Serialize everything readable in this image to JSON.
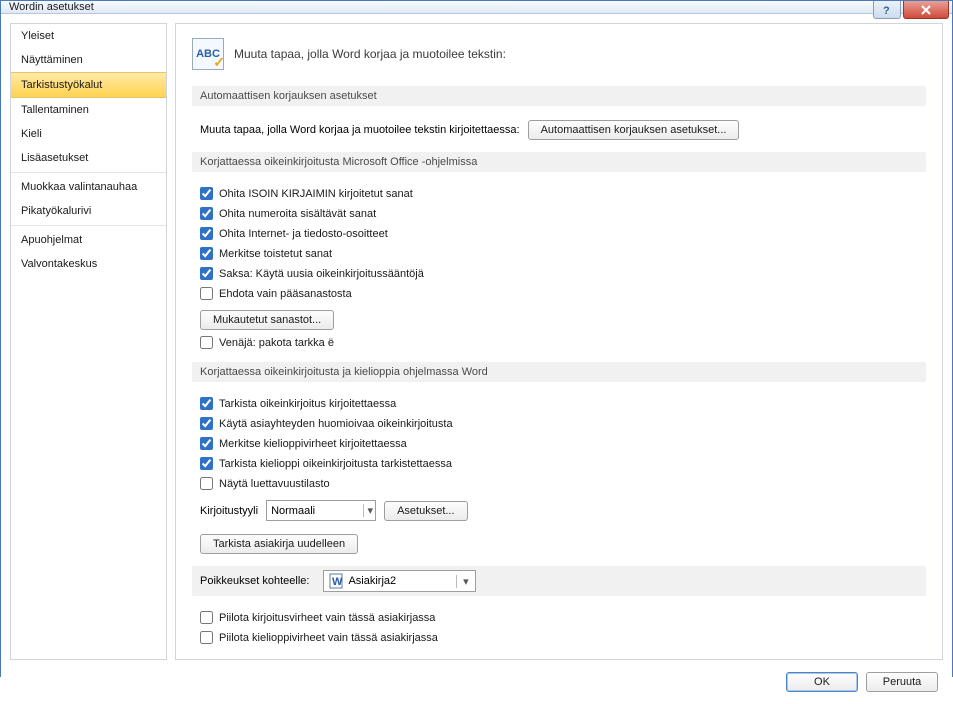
{
  "title": "Wordin asetukset",
  "sidebar": {
    "groups": [
      [
        "Yleiset",
        "Näyttäminen",
        "Tarkistustyökalut",
        "Tallentaminen",
        "Kieli",
        "Lisäasetukset"
      ],
      [
        "Muokkaa valintanauhaa",
        "Pikatyökalurivi"
      ],
      [
        "Apuohjelmat",
        "Valvontakeskus"
      ]
    ],
    "selected": "Tarkistustyökalut"
  },
  "page": {
    "icon_text": "ABC",
    "heading": "Muuta tapaa, jolla Word korjaa ja muotoilee tekstin:"
  },
  "sections": {
    "autocorrect": {
      "title": "Automaattisen korjauksen asetukset",
      "desc": "Muuta tapaa, jolla Word korjaa ja muotoilee tekstin kirjoitettaessa:",
      "button": "Automaattisen korjauksen asetukset..."
    },
    "office_spell": {
      "title": "Korjattaessa oikeinkirjoitusta Microsoft Office -ohjelmissa",
      "checks": [
        {
          "label": "Ohita ISOIN KIRJAIMIN kirjoitetut sanat",
          "checked": true
        },
        {
          "label": "Ohita numeroita sisältävät sanat",
          "checked": true
        },
        {
          "label": "Ohita Internet- ja tiedosto-osoitteet",
          "checked": true
        },
        {
          "label": "Merkitse toistetut sanat",
          "checked": true
        },
        {
          "label": "Saksa: Käytä uusia oikeinkirjoitussääntöjä",
          "checked": true
        },
        {
          "label": "Ehdota vain pääsanastosta",
          "checked": false
        }
      ],
      "custom_dict_button": "Mukautetut sanastot...",
      "russian": {
        "label": "Venäjä: pakota tarkka ë",
        "checked": false
      }
    },
    "word_spell": {
      "title": "Korjattaessa oikeinkirjoitusta ja kielioppia ohjelmassa Word",
      "checks": [
        {
          "label": "Tarkista oikeinkirjoitus kirjoitettaessa",
          "checked": true
        },
        {
          "label": "Käytä asiayhteyden huomioivaa oikeinkirjoitusta",
          "checked": true
        },
        {
          "label": "Merkitse kielioppivirheet kirjoitettaessa",
          "checked": true
        },
        {
          "label": "Tarkista kielioppi oikeinkirjoitusta tarkistettaessa",
          "checked": true
        },
        {
          "label": "Näytä luettavuustilasto",
          "checked": false
        }
      ],
      "writing_style_label": "Kirjoitustyyli",
      "writing_style_value": "Normaali",
      "settings_button": "Asetukset...",
      "recheck_button": "Tarkista asiakirja uudelleen"
    },
    "exceptions": {
      "label": "Poikkeukset kohteelle:",
      "doc": "Asiakirja2",
      "checks": [
        {
          "label": "Piilota kirjoitusvirheet vain tässä asiakirjassa",
          "checked": false
        },
        {
          "label": "Piilota kielioppivirheet vain tässä asiakirjassa",
          "checked": false
        }
      ]
    }
  },
  "footer": {
    "ok": "OK",
    "cancel": "Peruuta"
  }
}
